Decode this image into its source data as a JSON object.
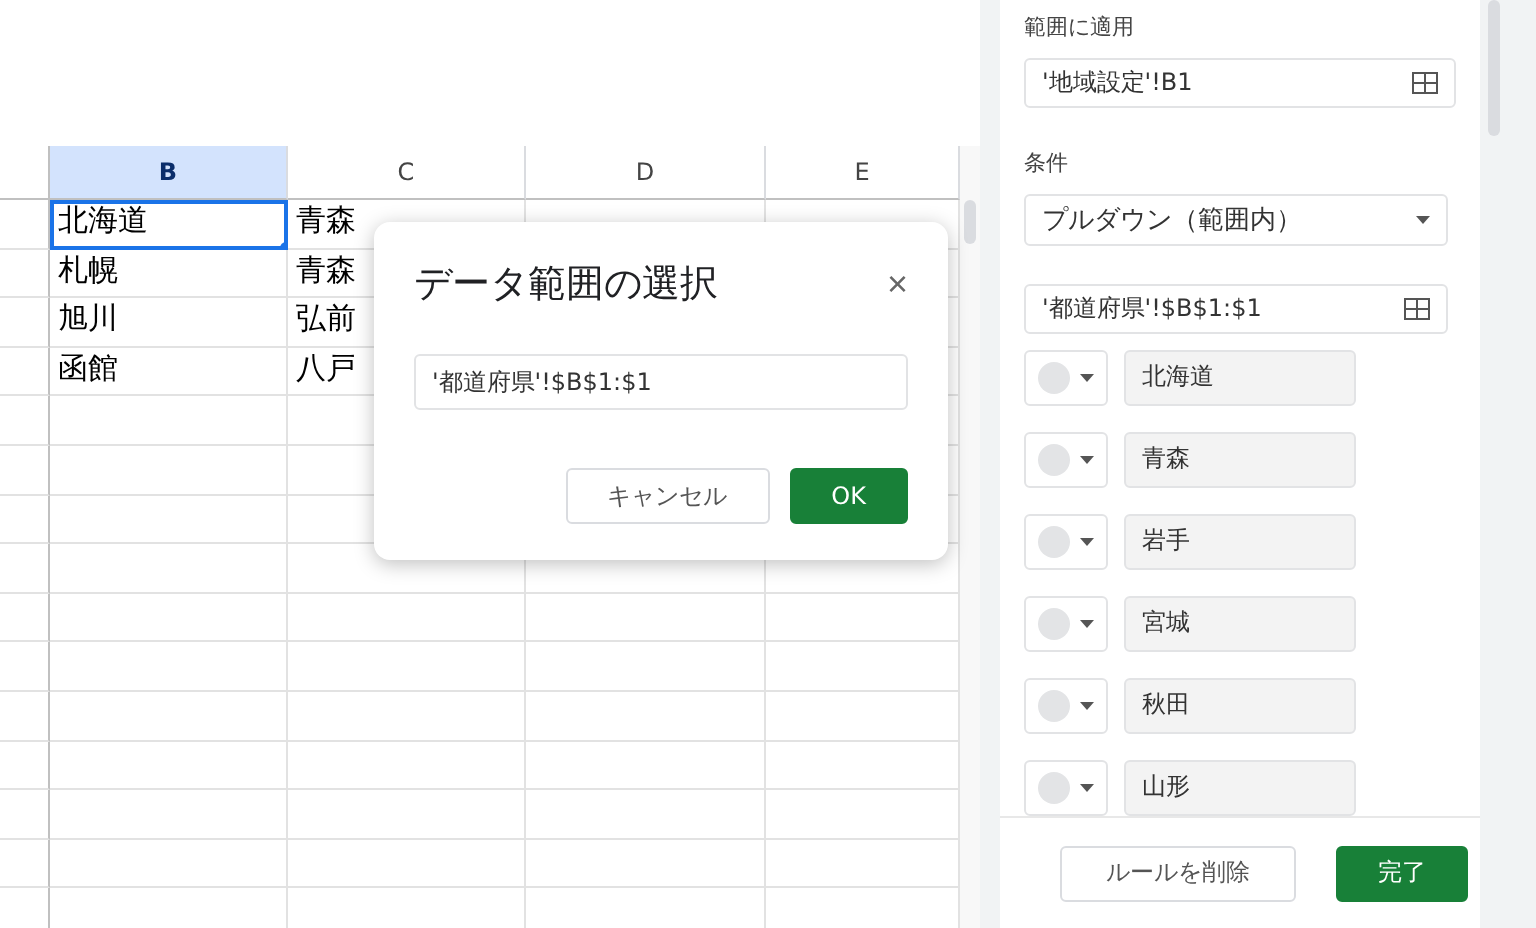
{
  "sheet": {
    "columns": [
      {
        "label": "B",
        "selected": true
      },
      {
        "label": "C",
        "selected": false
      },
      {
        "label": "D",
        "selected": false
      },
      {
        "label": "E",
        "selected": false
      }
    ],
    "rows": [
      [
        {
          "text": "北海道",
          "selected": true
        },
        {
          "text": "青森",
          "selected": false
        }
      ],
      [
        {
          "text": "札幌",
          "selected": false
        },
        {
          "text": "青森",
          "selected": false
        }
      ],
      [
        {
          "text": "旭川",
          "selected": false
        },
        {
          "text": "弘前",
          "selected": false
        }
      ],
      [
        {
          "text": "函館",
          "selected": false
        },
        {
          "text": "八戸",
          "selected": false
        }
      ]
    ]
  },
  "dialog": {
    "title": "データ範囲の選択",
    "close": "×",
    "range": "'都道府県'!$B$1:$1",
    "buttons": [
      {
        "label": "キャンセル",
        "kind": "secondary"
      },
      {
        "label": "OK",
        "kind": "primary"
      }
    ]
  },
  "panel": {
    "apply_label": "範囲に適用",
    "apply_range": "'地域設定'!B1",
    "condition_label": "条件",
    "condition": "プルダウン（範囲内）",
    "source_range": "'都道府県'!$B$1:$1",
    "items": [
      {
        "value": "北海道"
      },
      {
        "value": "青森"
      },
      {
        "value": "岩手"
      },
      {
        "value": "宮城"
      },
      {
        "value": "秋田"
      },
      {
        "value": "山形"
      }
    ],
    "buttons": [
      {
        "label": "ルールを削除",
        "kind": "secondary"
      },
      {
        "label": "完了",
        "kind": "primary"
      }
    ]
  }
}
